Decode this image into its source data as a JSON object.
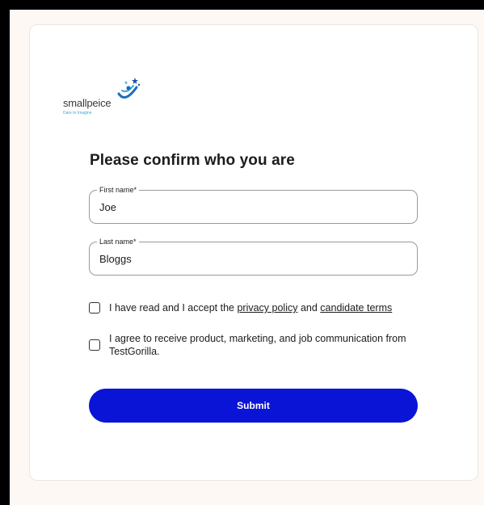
{
  "brand": {
    "logo_text": "smallpeice",
    "tagline": "Dare to Imagine",
    "accent_color": "#3aa9d6"
  },
  "form": {
    "title": "Please confirm who you are",
    "first_name": {
      "label": "First name*",
      "value": "Joe"
    },
    "last_name": {
      "label": "Last name*",
      "value": "Bloggs"
    },
    "consent_terms": {
      "prefix": "I have read and I accept the ",
      "privacy_link": "privacy policy",
      "middle": " and ",
      "terms_link": "candidate terms",
      "checked": false
    },
    "consent_marketing": {
      "text": "I agree to receive product, marketing, and job communication from TestGorilla.",
      "checked": false
    },
    "submit_label": "Submit",
    "submit_color": "#0a14d6"
  }
}
